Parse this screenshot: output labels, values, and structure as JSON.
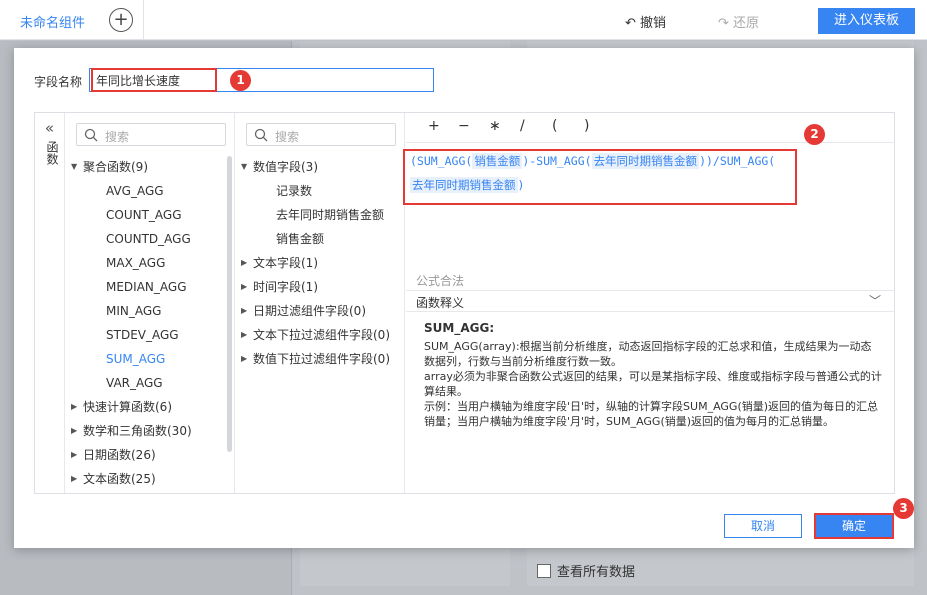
{
  "topbar": {
    "component_name": "未命名组件",
    "add_symbol": "+",
    "undo_label": "撤销",
    "redo_label": "还原",
    "enter_dashboard": "进入仪表板"
  },
  "background": {
    "view_all_data": "查看所有数据"
  },
  "dialog": {
    "field_name_label": "字段名称",
    "field_name_value": "年同比增长速度",
    "functions_toggle_label": "函数",
    "functions_search_placeholder": "搜索",
    "fields_search_placeholder": "搜索",
    "function_tree": [
      {
        "label": "聚合函数(9)",
        "expanded": true
      },
      {
        "label": "AVG_AGG",
        "leaf": true
      },
      {
        "label": "COUNT_AGG",
        "leaf": true
      },
      {
        "label": "COUNTD_AGG",
        "leaf": true
      },
      {
        "label": "MAX_AGG",
        "leaf": true
      },
      {
        "label": "MEDIAN_AGG",
        "leaf": true
      },
      {
        "label": "MIN_AGG",
        "leaf": true
      },
      {
        "label": "STDEV_AGG",
        "leaf": true
      },
      {
        "label": "SUM_AGG",
        "leaf": true,
        "active": true
      },
      {
        "label": "VAR_AGG",
        "leaf": true
      },
      {
        "label": "快速计算函数(6)",
        "expanded": false
      },
      {
        "label": "数学和三角函数(30)",
        "expanded": false
      },
      {
        "label": "日期函数(26)",
        "expanded": false
      },
      {
        "label": "文本函数(25)",
        "expanded": false
      }
    ],
    "field_tree": [
      {
        "label": "数值字段(3)",
        "expanded": true
      },
      {
        "label": "记录数",
        "leaf": true
      },
      {
        "label": "去年同时期销售金额",
        "leaf": true
      },
      {
        "label": "销售金额",
        "leaf": true
      },
      {
        "label": "文本字段(1)",
        "expanded": false
      },
      {
        "label": "时间字段(1)",
        "expanded": false
      },
      {
        "label": "日期过滤组件字段(0)",
        "expanded": false
      },
      {
        "label": "文本下拉过滤组件字段(0)",
        "expanded": false
      },
      {
        "label": "数值下拉过滤组件字段(0)",
        "expanded": false
      }
    ],
    "operators": [
      "+",
      "−",
      "∗",
      "/",
      "(",
      ")"
    ],
    "formula": {
      "p1": "(SUM_AGG(",
      "f1": "销售金额",
      "p2": ")-SUM_AGG(",
      "f2": "去年同时期销售金额",
      "p3": "))/SUM_AGG(",
      "f3": "去年同时期销售金额",
      "p4": ")"
    },
    "formula_status": "公式合法",
    "explain_title": "函数释义",
    "explain": {
      "fname": "SUM_AGG:",
      "line1": "SUM_AGG(array):根据当前分析维度，动态返回指标字段的汇总求和值，生成结果为一动态数据列，行数与当前分析维度行数一致。",
      "line2": " array必须为非聚合函数公式返回的结果，可以是某指标字段、维度或指标字段与普通公式的计算结果。",
      "line3": " 示例：当用户横轴为维度字段'日'时，纵轴的计算字段SUM_AGG(销量)返回的值为每日的汇总销量；当用户横轴为维度字段'月'时，SUM_AGG(销量)返回的值为每月的汇总销量。"
    },
    "cancel_label": "取消",
    "ok_label": "确定"
  },
  "annotations": [
    "1",
    "2",
    "3"
  ],
  "colors": {
    "accent": "#3685f2",
    "highlight": "#e53935"
  }
}
